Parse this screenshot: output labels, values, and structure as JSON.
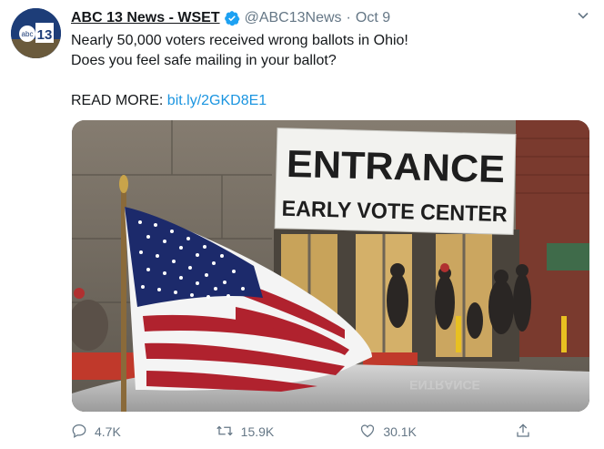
{
  "tweet": {
    "author_name": "ABC 13 News - WSET",
    "handle": "@ABC13News",
    "separator": "·",
    "date": "Oct 9",
    "text_line1": "Nearly 50,000 voters received wrong ballots in Ohio!",
    "text_line2": "Does you feel safe mailing in your ballot?",
    "read_more_label": "READ MORE:",
    "read_more_link": "bit.ly/2GKD8E1",
    "avatar_text": "abc 13"
  },
  "media": {
    "sign_line1": "ENTRANCE",
    "sign_line2": "EARLY VOTE CENTER",
    "car_decal_text": "ENTRANCE"
  },
  "actions": {
    "reply_count": "4.7K",
    "retweet_count": "15.9K",
    "like_count": "30.1K"
  },
  "colors": {
    "link": "#1b95e0",
    "muted": "#657786",
    "verified": "#1da1f2"
  }
}
